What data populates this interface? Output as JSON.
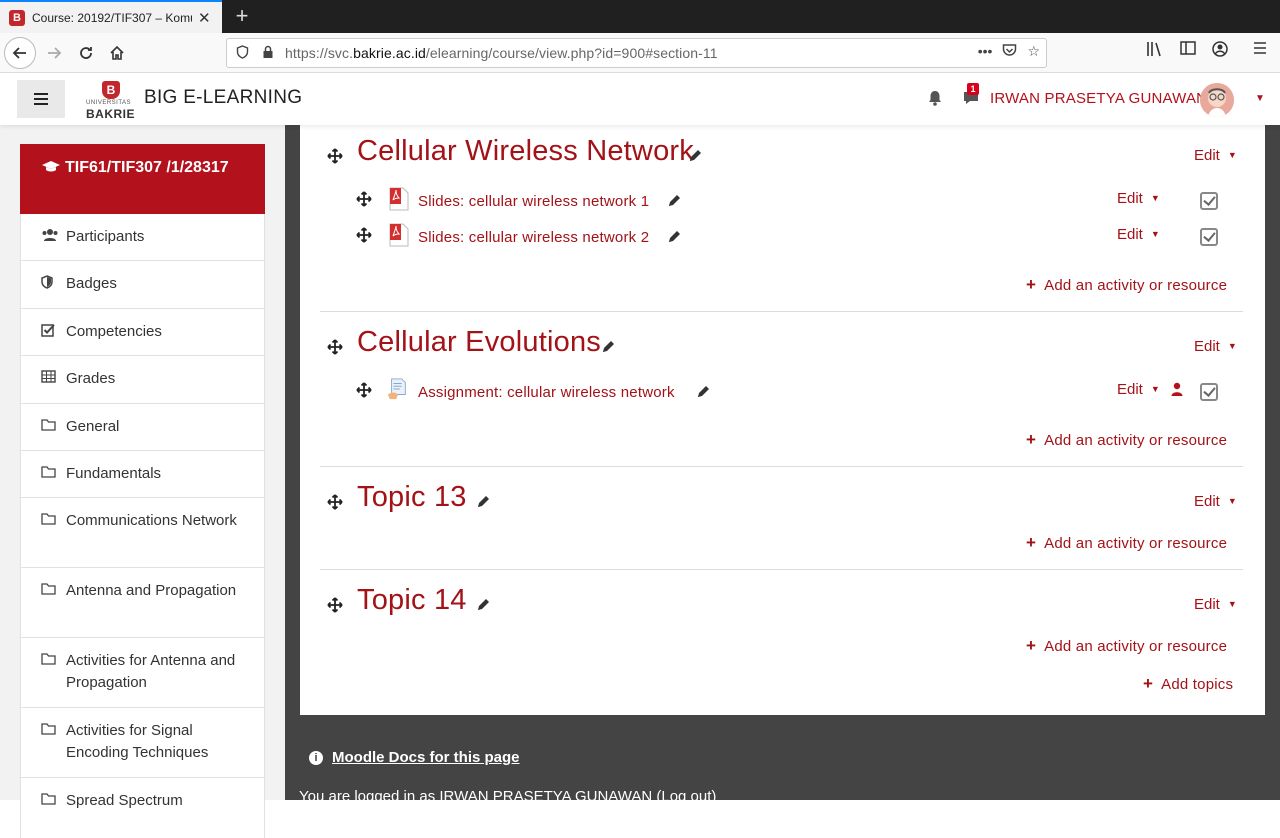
{
  "browser": {
    "tab_title": "Course: 20192/TIF307 – Komu",
    "url_prefix": "https://svc.",
    "url_domain": "bakrie.ac.id",
    "url_path": "/elearning/course/view.php?id=900#section-11",
    "new_tab": "+",
    "tab_close": "✕"
  },
  "header": {
    "site_name": "BIG E-LEARNING",
    "logo_top": "UNIVERSITAS",
    "logo_bottom": "BAKRIE",
    "logo_letter": "B",
    "message_count": "1",
    "username": "IRWAN PRASETYA GUNAWAN"
  },
  "drawer": {
    "course_title": "TIF61/TIF307 /1/28317",
    "items": [
      {
        "label": "Participants",
        "icon": "users-icon"
      },
      {
        "label": "Badges",
        "icon": "shield-icon"
      },
      {
        "label": "Competencies",
        "icon": "checkbox-icon"
      },
      {
        "label": "Grades",
        "icon": "table-icon"
      },
      {
        "label": "General",
        "icon": "folder-icon"
      },
      {
        "label": "Fundamentals",
        "icon": "folder-icon"
      },
      {
        "label": "Communications Network",
        "icon": "folder-icon"
      },
      {
        "label": "Antenna and Propagation",
        "icon": "folder-icon"
      },
      {
        "label": "Activities for Antenna and Propagation",
        "icon": "folder-icon"
      },
      {
        "label": "Activities for Signal Encoding Techniques",
        "icon": "folder-icon"
      },
      {
        "label": "Spread Spectrum",
        "icon": "folder-icon"
      }
    ]
  },
  "main": {
    "edit_label": "Edit",
    "add_activity_label": "Add an activity or resource",
    "add_topics_label": "Add topics",
    "sections": [
      {
        "title": "Cellular Wireless Network",
        "activities": [
          {
            "name": "Slides: cellular wireless network 1",
            "type": "pdf"
          },
          {
            "name": "Slides: cellular wireless network 2",
            "type": "pdf"
          }
        ]
      },
      {
        "title": "Cellular Evolutions",
        "activities": [
          {
            "name": "Assignment: cellular wireless network",
            "type": "assignment"
          }
        ]
      },
      {
        "title": "Topic 13",
        "activities": []
      },
      {
        "title": "Topic 14",
        "activities": []
      }
    ]
  },
  "footer": {
    "docs_link": "Moodle Docs for this page",
    "logged_in": "You are logged in as IRWAN PRASETYA GUNAWAN (Log out)"
  },
  "colors": {
    "brand": "#b3111b",
    "link": "#a31217",
    "footer_bg": "#444444"
  }
}
